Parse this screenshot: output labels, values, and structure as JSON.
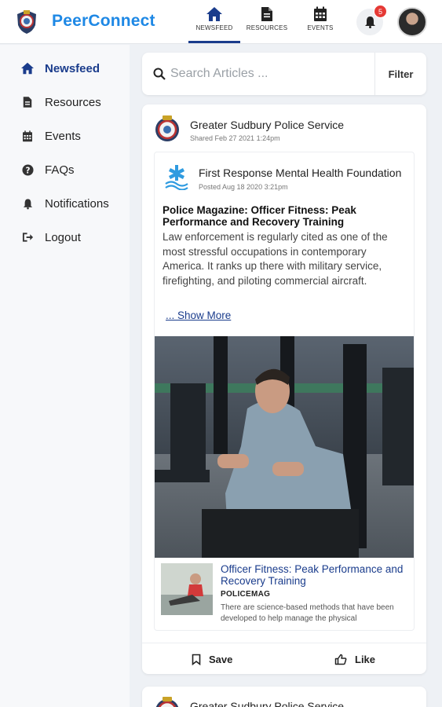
{
  "app": {
    "brand": "PeerConnect"
  },
  "topnav": {
    "items": [
      {
        "label": "NEWSFEED",
        "icon": "home-icon",
        "active": true
      },
      {
        "label": "RESOURCES",
        "icon": "document-icon",
        "active": false
      },
      {
        "label": "EVENTS",
        "icon": "calendar-icon",
        "active": false
      }
    ],
    "notification_count": "5"
  },
  "sidebar": {
    "items": [
      {
        "label": "Newsfeed",
        "icon": "home-icon"
      },
      {
        "label": "Resources",
        "icon": "document-icon"
      },
      {
        "label": "Events",
        "icon": "calendar-icon"
      },
      {
        "label": "FAQs",
        "icon": "question-icon"
      },
      {
        "label": "Notifications",
        "icon": "bell-icon"
      },
      {
        "label": "Logout",
        "icon": "logout-icon"
      }
    ]
  },
  "search": {
    "placeholder": "Search Articles ...",
    "filter_label": "Filter"
  },
  "posts": [
    {
      "author": "Greater Sudbury Police Service",
      "time": "Shared Feb 27 2021 1:24pm",
      "shared": {
        "author": "First Response Mental Health Foundation",
        "time": "Posted Aug 18 2020 3:21pm",
        "headline": "Police Magazine: Officer Fitness: Peak Performance and Recovery Training",
        "body": "Law enforcement is regularly cited as one of the most stressful occupations in contemporary America. It ranks up there with military service, firefighting, and piloting commercial aircraft.",
        "show_more": "... Show More",
        "link": {
          "title": "Officer Fitness: Peak Performance and Recovery Training",
          "source": "POLICEMAG",
          "description": "There are science-based methods that have been developed to help manage the physical"
        }
      },
      "actions": {
        "save": "Save",
        "like": "Like"
      }
    },
    {
      "author": "Greater Sudbury Police Service"
    }
  ],
  "colors": {
    "brand": "#1e88e5",
    "accent": "#1a3c8c",
    "badge": "#e53935"
  }
}
